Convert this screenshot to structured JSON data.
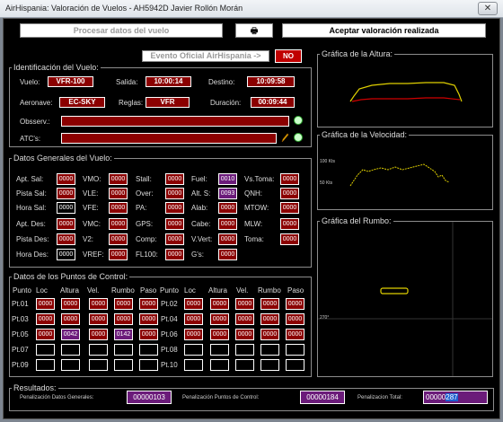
{
  "window": {
    "title": "AirHispania: Valoración de Vuelos - AH5942D Javier Rollón Morán",
    "close_symbol": "✕"
  },
  "toolbar": {
    "process_label": "Procesar datos del vuelo",
    "print_symbol": "🖶",
    "accept_label": "Aceptar valoración realizada"
  },
  "event": {
    "label": "Evento Oficial AirHispania ->",
    "value": "NO"
  },
  "identification": {
    "legend": "Identificación del Vuelo:",
    "flight_label": "Vuelo:",
    "flight": "VFR-100",
    "departure_label": "Salida:",
    "departure": "10:00:14",
    "destination_label": "Destino:",
    "destination": "10:09:58",
    "aircraft_label": "Aeronave:",
    "aircraft": "EC-SKY",
    "rules_label": "Reglas:",
    "rules": "VFR",
    "duration_label": "Duración:",
    "duration": "00:09:44",
    "observ_label": "Obsserv.:",
    "atc_label": "ATC's:"
  },
  "general": {
    "legend": "Datos Generales del Vuelo:",
    "rows": [
      [
        {
          "label": "Apt. Sal:",
          "value": "0000"
        },
        {
          "label": "VMO:",
          "value": "0000"
        },
        {
          "label": "Stall:",
          "value": "0000"
        },
        {
          "label": "Fuel:",
          "value": "0010",
          "purple": true
        },
        {
          "label": "Vs.Toma:",
          "value": "0000"
        }
      ],
      [
        {
          "label": "Pista Sal:",
          "value": "0000"
        },
        {
          "label": "VLE:",
          "value": "0000"
        },
        {
          "label": "Over:",
          "value": "0000"
        },
        {
          "label": "Alt. S:",
          "value": "0093",
          "purple": true
        },
        {
          "label": "QNH:",
          "value": "0000"
        }
      ],
      [
        {
          "label": "Hora Sal:",
          "value": "0000",
          "empty": true
        },
        {
          "label": "VFE:",
          "value": "0000"
        },
        {
          "label": "PA:",
          "value": "0000"
        },
        {
          "label": "Alab:",
          "value": "0000"
        },
        {
          "label": "MTOW:",
          "value": "0000"
        }
      ],
      [
        {
          "label": "Apt. Des:",
          "value": "0000"
        },
        {
          "label": "VMC:",
          "value": "0000"
        },
        {
          "label": "GPS:",
          "value": "0000"
        },
        {
          "label": "Cabe:",
          "value": "0000"
        },
        {
          "label": "MLW:",
          "value": "0000"
        }
      ],
      [
        {
          "label": "Pista Des:",
          "value": "0000"
        },
        {
          "label": "V2:",
          "value": "0000"
        },
        {
          "label": "Comp:",
          "value": "0000"
        },
        {
          "label": "V.Vert:",
          "value": "0000"
        },
        {
          "label": "Toma:",
          "value": "0000"
        }
      ],
      [
        {
          "label": "Hora Des:",
          "value": "0000",
          "empty": true
        },
        {
          "label": "VREF:",
          "value": "0000"
        },
        {
          "label": "FL100:",
          "value": "0000"
        },
        {
          "label": "G's:",
          "value": "0000"
        },
        null
      ]
    ]
  },
  "control": {
    "legend": "Datos de los Puntos de Control:",
    "headers": [
      "Punto",
      "Loc",
      "Altura",
      "Vel.",
      "Rumbo",
      "Paso"
    ],
    "left": [
      {
        "label": "Pt.01",
        "cells": [
          {
            "v": "0000"
          },
          {
            "v": "0000"
          },
          {
            "v": "0000"
          },
          {
            "v": "0000"
          },
          {
            "v": "0000"
          }
        ]
      },
      {
        "label": "Pt.03",
        "cells": [
          {
            "v": "0000"
          },
          {
            "v": "0000"
          },
          {
            "v": "0000"
          },
          {
            "v": "0000"
          },
          {
            "v": "0000"
          }
        ]
      },
      {
        "label": "Pt.05",
        "cells": [
          {
            "v": "0000"
          },
          {
            "v": "0042",
            "p": true
          },
          {
            "v": "0000"
          },
          {
            "v": "0142",
            "p": true
          },
          {
            "v": "0000"
          }
        ]
      },
      {
        "label": "Pt.07",
        "cells": [
          {
            "v": "",
            "e": true
          },
          {
            "v": "",
            "e": true
          },
          {
            "v": "",
            "e": true
          },
          {
            "v": "",
            "e": true
          },
          {
            "v": "",
            "e": true
          }
        ]
      },
      {
        "label": "Pt.09",
        "cells": [
          {
            "v": "",
            "e": true
          },
          {
            "v": "",
            "e": true
          },
          {
            "v": "",
            "e": true
          },
          {
            "v": "",
            "e": true
          },
          {
            "v": "",
            "e": true
          }
        ]
      }
    ],
    "right": [
      {
        "label": "Pt.02",
        "cells": [
          {
            "v": "0000"
          },
          {
            "v": "0000"
          },
          {
            "v": "0000"
          },
          {
            "v": "0000"
          },
          {
            "v": "0000"
          }
        ]
      },
      {
        "label": "Pt.04",
        "cells": [
          {
            "v": "0000"
          },
          {
            "v": "0000"
          },
          {
            "v": "0000"
          },
          {
            "v": "0000"
          },
          {
            "v": "0000"
          }
        ]
      },
      {
        "label": "Pt.06",
        "cells": [
          {
            "v": "0000"
          },
          {
            "v": "0000"
          },
          {
            "v": "0000"
          },
          {
            "v": "0000"
          },
          {
            "v": "0000"
          }
        ]
      },
      {
        "label": "Pt.08",
        "cells": [
          {
            "v": "",
            "e": true
          },
          {
            "v": "",
            "e": true
          },
          {
            "v": "",
            "e": true
          },
          {
            "v": "",
            "e": true
          },
          {
            "v": "",
            "e": true
          }
        ]
      },
      {
        "label": "Pt.10",
        "cells": [
          {
            "v": "",
            "e": true
          },
          {
            "v": "",
            "e": true
          },
          {
            "v": "",
            "e": true
          },
          {
            "v": "",
            "e": true
          },
          {
            "v": "",
            "e": true
          }
        ]
      }
    ]
  },
  "results": {
    "legend": "Resultados:",
    "general_label": "Penalización Datos Generales:",
    "general": "00000103",
    "control_label": "Penalización Puntos de Control:",
    "control": "00000184",
    "total_label": "Penalizacion Total:",
    "total_prefix": "00000",
    "total_selected": "287"
  },
  "charts": {
    "altitude": {
      "legend": "Gráfica de la Altura:"
    },
    "speed": {
      "legend": "Gráfica de la Velocidad:",
      "y_label_top": "100 Kts",
      "y_label_bottom": "50 Kts"
    },
    "heading": {
      "legend": "Gráfica del Rumbo:",
      "y_label": "270°"
    }
  },
  "colors": {
    "field_red": "#8b0000",
    "field_purple": "#6b1b7a",
    "altitude_line": "#e0d000",
    "altitude_ref": "#d00000",
    "speed_line": "#e0d000",
    "heading_line": "#e0d000"
  }
}
